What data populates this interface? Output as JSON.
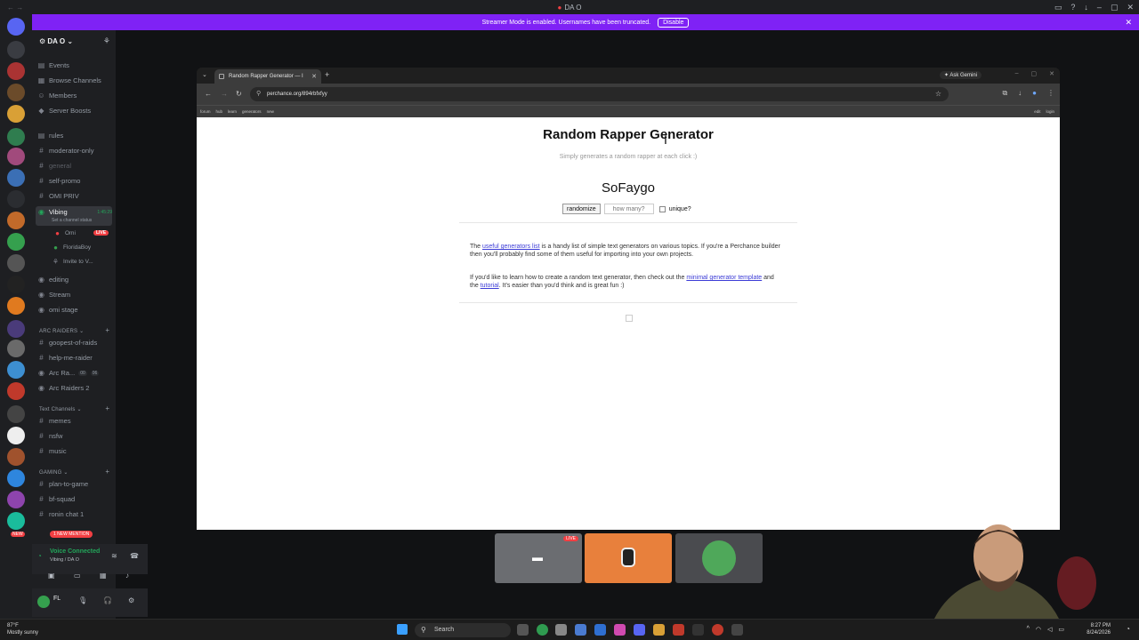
{
  "titlebar": {
    "title": "DA O"
  },
  "streamer_banner": {
    "text": "Streamer Mode is enabled. Usernames have been truncated.",
    "button": "Disable"
  },
  "sidebar": {
    "server_name": "DA O",
    "nav": [
      {
        "icon": "calendar-icon",
        "label": "Events"
      },
      {
        "icon": "browse-icon",
        "label": "Browse Channels"
      },
      {
        "icon": "members-icon",
        "label": "Members"
      },
      {
        "icon": "boost-icon",
        "label": "Server Boosts"
      }
    ],
    "channels_top": [
      "rules",
      "moderator-only",
      "general",
      "self-promo",
      "OMI PRIV"
    ],
    "voice_active": {
      "name": "Vibing",
      "status": "Set a channel status",
      "time": "1:45:29"
    },
    "voice_members": [
      {
        "name": "Omi",
        "badge": "LIVE"
      },
      {
        "name": "FloridaBoy"
      },
      {
        "name": "Invite to V..."
      }
    ],
    "channels_mid": [
      "editing",
      "Stream",
      "omi stage"
    ],
    "arc_category": "ARC RAIDERS",
    "arc_channels": [
      "goopest-of-raids",
      "help-me-raider",
      "Arc Ra...",
      "Arc Raiders 2"
    ],
    "arc_counts": [
      "00",
      "06"
    ],
    "text_category": "Text Channels",
    "text_channels": [
      "memes",
      "nsfw",
      "music"
    ],
    "gaming_category": "GAMING",
    "gaming_channels": [
      "plan-to-game",
      "bf-squad",
      "ronin chat 1"
    ],
    "mention_badge": "1 NEW MENTION",
    "voice_panel": {
      "title": "Voice Connected",
      "sub": "Vibing / DA O"
    },
    "user": {
      "name": "FL"
    },
    "rail_badges": [
      "NEW"
    ]
  },
  "browser": {
    "tab_title": "Random Rapper Generator — I",
    "ask": "Ask Gemini",
    "url": "perchance.org/894rbfxfyy",
    "bookmarks": [
      "forum",
      "hub",
      "learn",
      "generators",
      "new"
    ],
    "bookmarks_right": [
      "edit",
      "login"
    ]
  },
  "page": {
    "title": "Random Rapper Generator",
    "subtitle": "Simply generates a random rapper at each click :)",
    "output": "SoFaygo",
    "randomize": "randomize",
    "howmany_placeholder": "how many?",
    "unique": "unique?",
    "p1_pre": "The ",
    "p1_link": "useful generators list",
    "p1_post": " is a handy list of simple text generators on various topics. If you're a Perchance builder then you'll probably find some of them useful for importing into your own projects.",
    "p2_pre": "If you'd like to learn how to create a random text generator, then check out the ",
    "p2_link1": "minimal generator template",
    "p2_mid": " and the ",
    "p2_link2": "tutorial",
    "p2_post": ". It's easier than you'd think and is great fun :)"
  },
  "call": {
    "live_badge": "LIVE"
  },
  "taskbar": {
    "weather_temp": "87°F",
    "weather_desc": "Mostly sunny",
    "search": "Search",
    "time": "8:27 PM",
    "date": "8/24/2026"
  }
}
